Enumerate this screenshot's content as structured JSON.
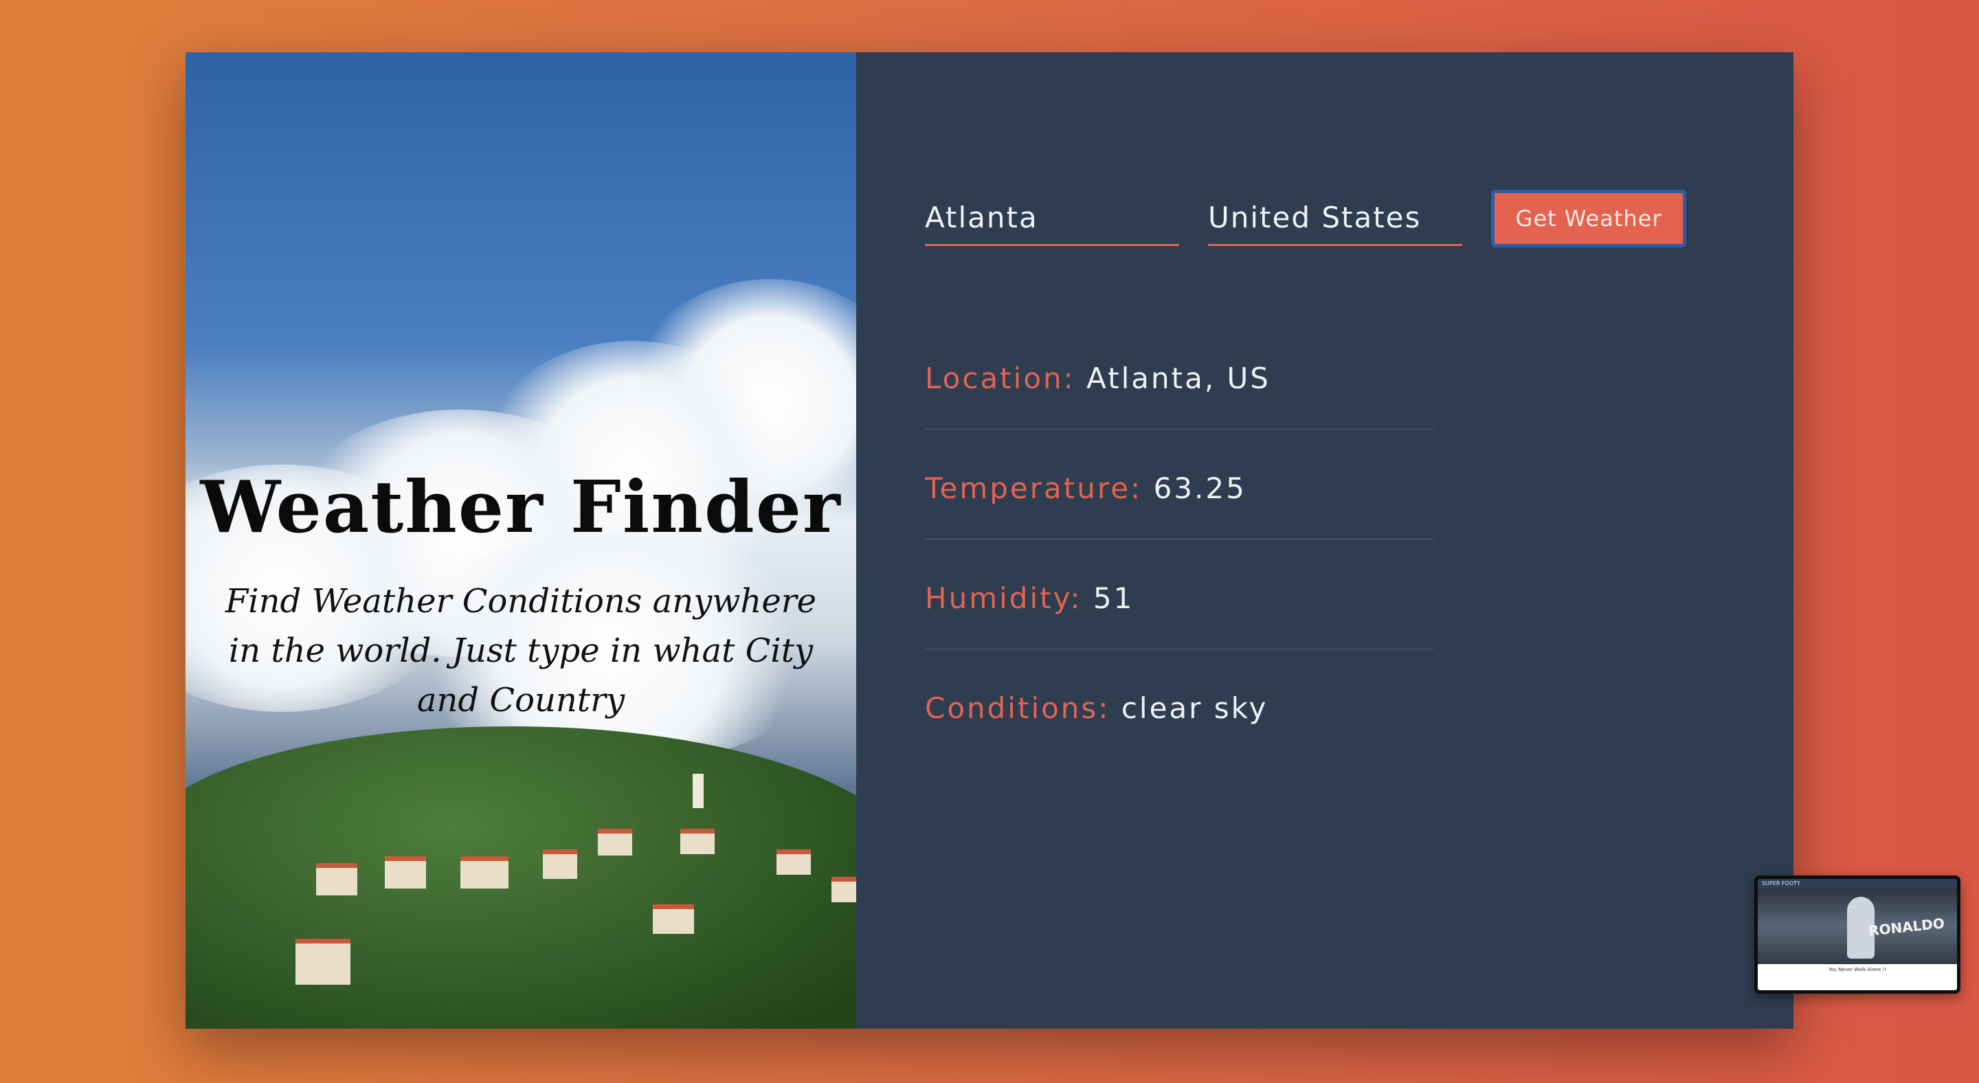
{
  "hero": {
    "title": "Weather Finder",
    "subtitle": "Find Weather Conditions anywhere in the world. Just type in what City and Country"
  },
  "form": {
    "city_value": "Atlanta",
    "country_value": "United States",
    "submit_label": "Get Weather"
  },
  "results": [
    {
      "label": "Location:",
      "value": "Atlanta, US"
    },
    {
      "label": "Temperature:",
      "value": "63.25"
    },
    {
      "label": "Humidity:",
      "value": "51"
    },
    {
      "label": "Conditions:",
      "value": "clear sky"
    }
  ],
  "thumbnail": {
    "bar_title": "SUPER FOOTY",
    "hero_text": "RONALDO",
    "caption": "You Never Walk Alone !!"
  },
  "colors": {
    "accent": "#e26453",
    "panel": "#2e3d4f",
    "button_border": "#2f5ea9"
  }
}
